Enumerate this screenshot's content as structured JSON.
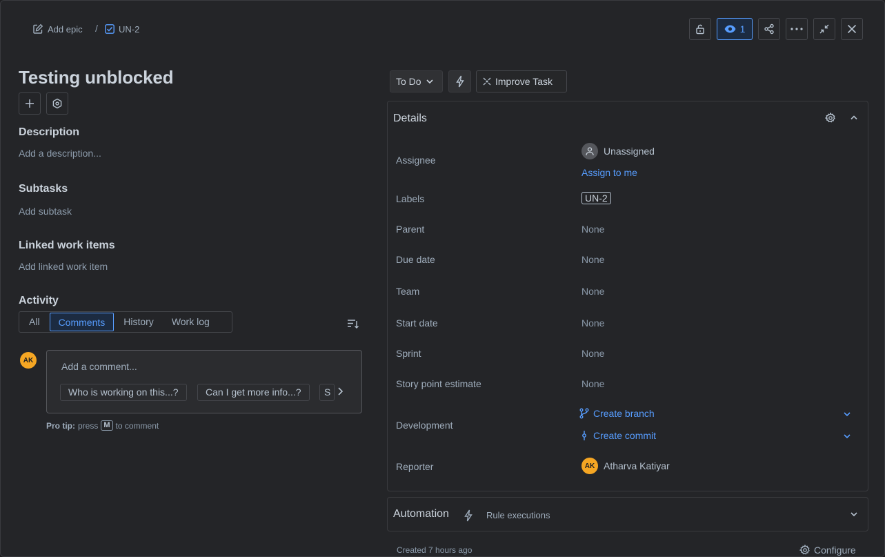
{
  "breadcrumb": {
    "epic_label": "Add epic",
    "separator": "/",
    "issue_key": "UN-2"
  },
  "toolbar": {
    "watch_count": "1"
  },
  "issue": {
    "title": "Testing unblocked"
  },
  "sections": {
    "description_heading": "Description",
    "description_placeholder": "Add a description...",
    "subtasks_heading": "Subtasks",
    "subtasks_placeholder": "Add subtask",
    "linked_heading": "Linked work items",
    "linked_placeholder": "Add linked work item",
    "activity_heading": "Activity"
  },
  "activity": {
    "tabs": [
      {
        "label": "All"
      },
      {
        "label": "Comments"
      },
      {
        "label": "History"
      },
      {
        "label": "Work log"
      }
    ],
    "active_tab": "Comments",
    "avatar_initials": "AK",
    "comment_placeholder": "Add a comment...",
    "suggestions": [
      "Who is working on this...?",
      "Can I get more info...?",
      "S"
    ],
    "protip_bold": "Pro tip:",
    "protip_press": "press",
    "protip_key": "M",
    "protip_rest": "to comment"
  },
  "status": {
    "current": "To Do",
    "improve_label": "Improve Task"
  },
  "details": {
    "heading": "Details",
    "assignee_label": "Assignee",
    "assignee_value": "Unassigned",
    "assign_to_me": "Assign to me",
    "labels_label": "Labels",
    "labels_value": "UN-2",
    "parent_label": "Parent",
    "parent_value": "None",
    "due_label": "Due date",
    "due_value": "None",
    "team_label": "Team",
    "team_value": "None",
    "start_label": "Start date",
    "start_value": "None",
    "sprint_label": "Sprint",
    "sprint_value": "None",
    "story_label": "Story point estimate",
    "story_value": "None",
    "dev_label": "Development",
    "create_branch": "Create branch",
    "create_commit": "Create commit",
    "reporter_label": "Reporter",
    "reporter_initials": "AK",
    "reporter_name": "Atharva Katiyar"
  },
  "automation": {
    "heading": "Automation",
    "rule_executions": "Rule executions"
  },
  "footer": {
    "created": "Created 7 hours ago",
    "configure": "Configure"
  },
  "colors": {
    "accent": "#579dff",
    "avatar": "#f5a623",
    "background": "#242528"
  }
}
